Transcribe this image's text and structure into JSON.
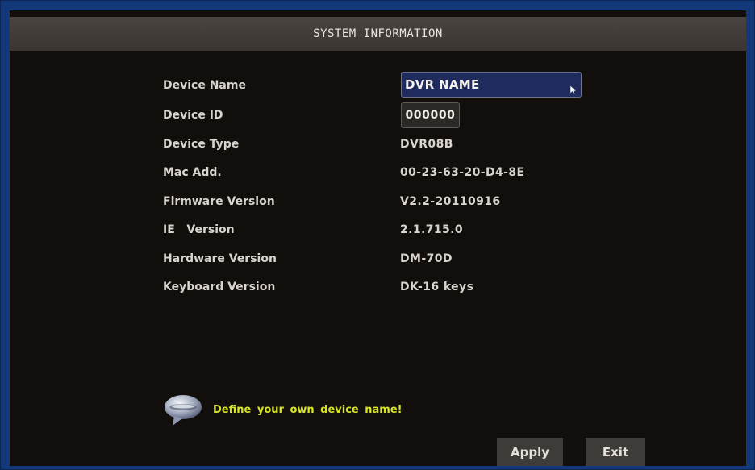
{
  "window": {
    "title": "SYSTEM INFORMATION"
  },
  "info": {
    "rows": [
      {
        "label": "Device Name",
        "value": "DVR NAME"
      },
      {
        "label": "Device ID",
        "value": "000000"
      },
      {
        "label": "Device Type",
        "value": "DVR08B"
      },
      {
        "label": "Mac Add.",
        "value": "00-23-63-20-D4-8E"
      },
      {
        "label": "Firmware Version",
        "value": "V2.2-20110916"
      },
      {
        "label": "IE   Version",
        "value": "2.1.715.0"
      },
      {
        "label": "Hardware Version",
        "value": "DM-70D"
      },
      {
        "label": "Keyboard Version",
        "value": "DK-16 keys"
      }
    ]
  },
  "hint": {
    "icon": "speech-bubble-icon",
    "text": "Define your own device name!"
  },
  "buttons": {
    "apply": "Apply",
    "exit": "Exit"
  },
  "colors": {
    "frame": "#14397a",
    "screen_background": "#120e0b",
    "title_bar": "#423d3a",
    "name_field": "#1f2b5c",
    "hint_text": "#d7e526",
    "button": "#3f3b39"
  }
}
